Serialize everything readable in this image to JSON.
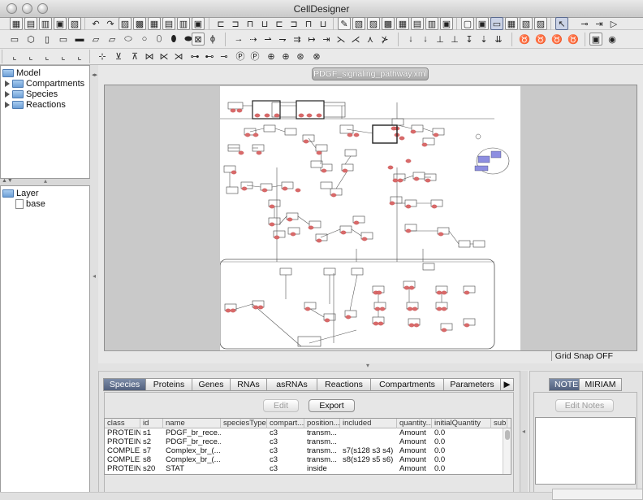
{
  "window": {
    "title": "CellDesigner"
  },
  "document_tab": {
    "label": "PDGF_signaling_pathway.xml"
  },
  "tree": {
    "items": [
      {
        "label": "Model"
      },
      {
        "label": "Compartments"
      },
      {
        "label": "Species"
      },
      {
        "label": "Reactions"
      }
    ]
  },
  "layer": {
    "root": "Layer",
    "child": "base"
  },
  "status": {
    "grid_snap": "Grid Snap OFF"
  },
  "bottom_tabs": [
    "Species",
    "Proteins",
    "Genes",
    "RNAs",
    "asRNAs",
    "Reactions",
    "Compartments",
    "Parameters"
  ],
  "buttons": {
    "edit": "Edit",
    "export": "Export",
    "edit_notes": "Edit Notes"
  },
  "note_tabs": [
    "NOTE",
    "MIRIAM"
  ],
  "table": {
    "columns": [
      "class",
      "id",
      "name",
      "speciesType",
      "compart...",
      "position...",
      "included",
      "quantity...",
      "initialQuantity",
      "sub"
    ],
    "rows": [
      [
        "PROTEIN",
        "s1",
        "PDGF_br_rece...",
        "",
        "c3",
        "transm...",
        "",
        "Amount",
        "0.0",
        ""
      ],
      [
        "PROTEIN",
        "s2",
        "PDGF_br_rece...",
        "",
        "c3",
        "transm...",
        "",
        "Amount",
        "0.0",
        ""
      ],
      [
        "COMPLEX",
        "s7",
        "Complex_br_(...",
        "",
        "c3",
        "transm...",
        "s7(s128 s3 s4)",
        "Amount",
        "0.0",
        ""
      ],
      [
        "COMPLEX",
        "s8",
        "Complex_br_(...",
        "",
        "c3",
        "transm...",
        "s8(s129 s5 s6)",
        "Amount",
        "0.0",
        ""
      ],
      [
        "PROTEIN",
        "s20",
        "STAT",
        "",
        "c3",
        "inside",
        "",
        "Amount",
        "0.0",
        ""
      ]
    ]
  },
  "colors": {
    "species_node_red": "#d96a6a",
    "complex_node_blue": "#8d8ee0",
    "active_tab": "#5a6a88"
  }
}
